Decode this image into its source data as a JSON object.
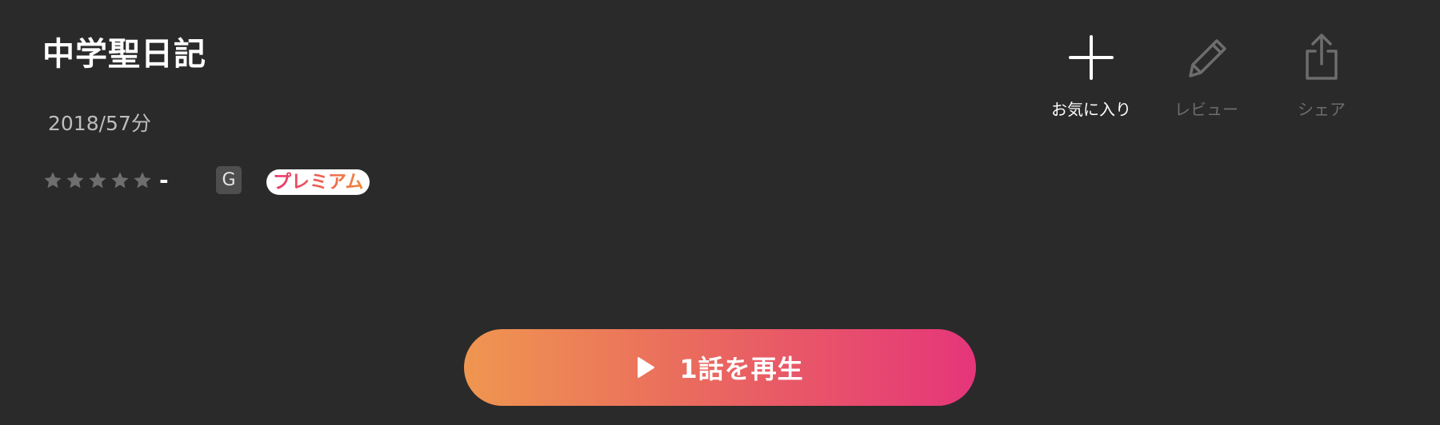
{
  "title": "中学聖日記",
  "meta": "2018/57分",
  "rating": {
    "stars_filled": 0,
    "stars_total": 5,
    "star_color": "#6e6e6e",
    "value": "-"
  },
  "badges": {
    "age_rating": "G",
    "premium": "プレミアム"
  },
  "actions": {
    "favorite": {
      "label": "お気に入り",
      "icon": "plus-icon"
    },
    "review": {
      "label": "レビュー",
      "icon": "pencil-icon"
    },
    "share": {
      "label": "シェア",
      "icon": "share-icon"
    }
  },
  "play_button": {
    "label": "1話を再生",
    "icon": "play-icon"
  },
  "colors": {
    "background": "#2a2a2a",
    "accent_start": "#ef9650",
    "accent_end": "#e5357a",
    "disabled": "#6d6d6d"
  }
}
